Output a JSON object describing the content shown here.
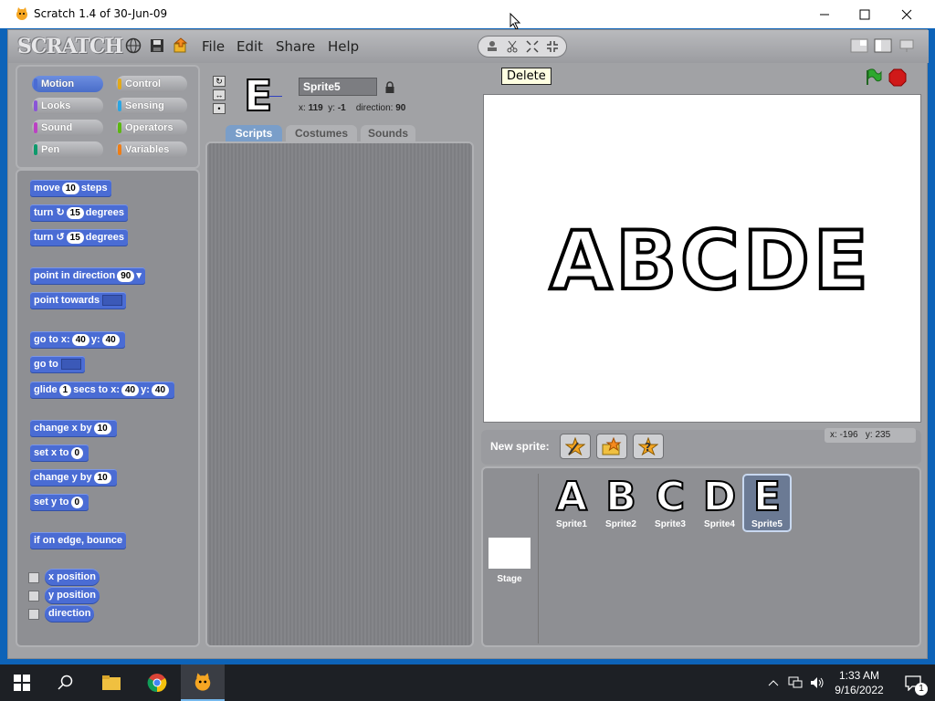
{
  "window": {
    "title": "Scratch 1.4 of 30-Jun-09"
  },
  "menu": {
    "logo": "SCRATCH",
    "items": [
      "File",
      "Edit",
      "Share",
      "Help"
    ]
  },
  "tooltip": "Delete",
  "categories": [
    {
      "label": "Motion",
      "color": "#4a6cd4",
      "selected": true
    },
    {
      "label": "Control",
      "color": "#e1a91a"
    },
    {
      "label": "Looks",
      "color": "#8a55d7"
    },
    {
      "label": "Sensing",
      "color": "#2ca5e2"
    },
    {
      "label": "Sound",
      "color": "#bb42c3"
    },
    {
      "label": "Operators",
      "color": "#5cb712"
    },
    {
      "label": "Pen",
      "color": "#0e9a6c"
    },
    {
      "label": "Variables",
      "color": "#ee7d16"
    }
  ],
  "blocks": {
    "move": {
      "a": "move",
      "n": "10",
      "b": "steps"
    },
    "turn_cw": {
      "a": "turn",
      "n": "15",
      "b": "degrees"
    },
    "turn_ccw": {
      "a": "turn",
      "n": "15",
      "b": "degrees"
    },
    "point_dir": {
      "a": "point in direction",
      "n": "90"
    },
    "point_towards": {
      "a": "point towards"
    },
    "goto_xy": {
      "a": "go to x:",
      "n1": "40",
      "b": "y:",
      "n2": "40"
    },
    "goto": {
      "a": "go to"
    },
    "glide": {
      "a": "glide",
      "n1": "1",
      "b": "secs to x:",
      "n2": "40",
      "c": "y:",
      "n3": "40"
    },
    "change_x": {
      "a": "change x by",
      "n": "10"
    },
    "set_x": {
      "a": "set x to",
      "n": "0"
    },
    "change_y": {
      "a": "change y by",
      "n": "10"
    },
    "set_y": {
      "a": "set y to",
      "n": "0"
    },
    "bounce": {
      "a": "if on edge, bounce"
    },
    "xpos": "x position",
    "ypos": "y position",
    "direction": "direction"
  },
  "sprite": {
    "name": "Sprite5",
    "glyph": "E",
    "x_label": "x:",
    "x": "119",
    "y_label": "y:",
    "y": "-1",
    "dir_label": "direction:",
    "dir": "90"
  },
  "tabs": [
    "Scripts",
    "Costumes",
    "Sounds"
  ],
  "stage": {
    "text": "ABCDE"
  },
  "mouse": {
    "x_label": "x:",
    "x": "-196",
    "y_label": "y:",
    "y": "235"
  },
  "new_sprite_label": "New sprite:",
  "sprites": [
    {
      "glyph": "A",
      "label": "Sprite1"
    },
    {
      "glyph": "B",
      "label": "Sprite2"
    },
    {
      "glyph": "C",
      "label": "Sprite3"
    },
    {
      "glyph": "D",
      "label": "Sprite4"
    },
    {
      "glyph": "E",
      "label": "Sprite5",
      "selected": true
    }
  ],
  "stage_thumb_label": "Stage",
  "clock": {
    "time": "1:33 AM",
    "date": "9/16/2022",
    "notif": "1"
  }
}
